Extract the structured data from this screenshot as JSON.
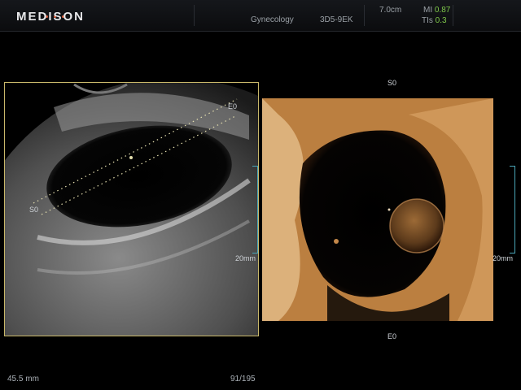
{
  "header": {
    "brand": "MEDISON",
    "application": "Gynecology",
    "probe": "3D5-9EK",
    "depth": "7.0cm",
    "mi_label": "MI",
    "mi_value": "0.87",
    "tis_label": "TIs",
    "tis_value": "0.3"
  },
  "left_view": {
    "start_marker": "S0",
    "end_marker": "E0",
    "scale_label": "20mm"
  },
  "right_view": {
    "start_marker": "S0",
    "end_marker": "E0",
    "scale_label": "20mm"
  },
  "footer": {
    "measurement": "45.5 mm",
    "frame_counter": "91/195"
  },
  "colors": {
    "roi_border": "#c9b86a",
    "parameter_value": "#7fc84a",
    "scale_bracket": "#4aa6b8"
  }
}
